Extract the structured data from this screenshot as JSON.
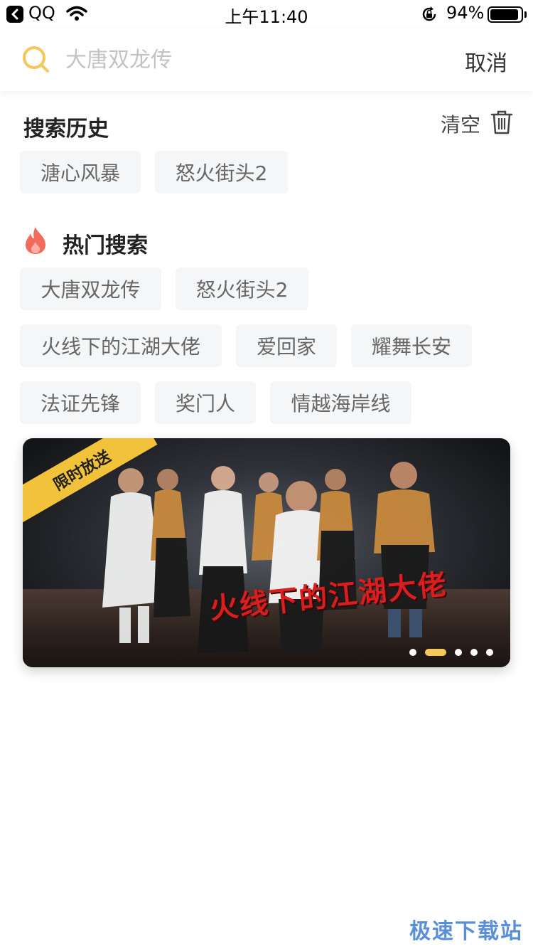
{
  "status_bar": {
    "back_app": "QQ",
    "time": "上午11:40",
    "battery_text": "94%",
    "battery_level": 0.94
  },
  "search": {
    "placeholder": "大唐双龙传",
    "cancel_label": "取消",
    "accent_color": "#f6c75b"
  },
  "history": {
    "title": "搜索历史",
    "clear_label": "清空",
    "items": [
      "溏心风暴",
      "怒火街头2"
    ]
  },
  "hot": {
    "title": "热门搜索",
    "icon": "fire-icon",
    "icon_color": "#f06c5c",
    "items": [
      "大唐双龙传",
      "怒火街头2",
      "火线下的江湖大佬",
      "爱回家",
      "耀舞长安",
      "法证先锋",
      "奖门人",
      "情越海岸线"
    ]
  },
  "banner": {
    "ribbon_label": "限时放送",
    "title": "火线下的江湖大佬",
    "ribbon_color": "#f2c23a",
    "dots_total": 5,
    "active_dot": 2
  },
  "watermark": "极速下载站"
}
